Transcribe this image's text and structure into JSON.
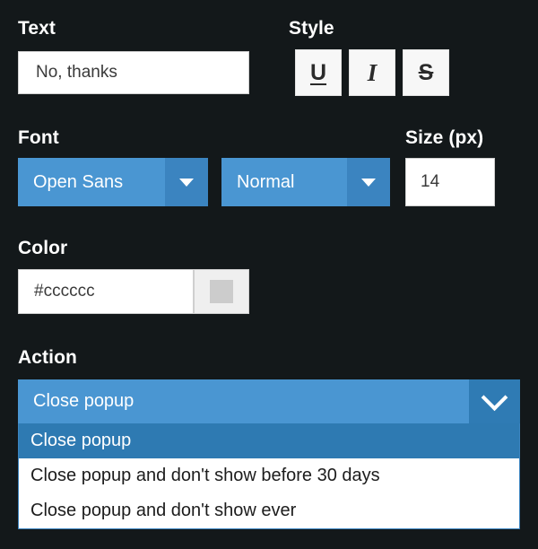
{
  "text_section": {
    "label": "Text",
    "value": "No, thanks",
    "placeholder": "Text"
  },
  "style_section": {
    "label": "Style",
    "buttons": [
      {
        "name": "underline",
        "glyph": "U"
      },
      {
        "name": "italic",
        "glyph": "I"
      },
      {
        "name": "strikethrough",
        "glyph": "S"
      }
    ]
  },
  "font_section": {
    "label": "Font",
    "family": {
      "value": "Open Sans"
    },
    "weight": {
      "value": "Normal"
    }
  },
  "size_section": {
    "label": "Size (px)",
    "value": "14",
    "placeholder": "14"
  },
  "color_section": {
    "label": "Color",
    "value": "#cccccc",
    "placeholder": "#cccccc",
    "swatch_color": "#cccccc"
  },
  "action_section": {
    "label": "Action",
    "selected": "Close popup",
    "options": [
      "Close popup",
      "Close popup and don't show before 30 days",
      "Close popup and don't show ever"
    ]
  },
  "colors": {
    "background": "#13181a",
    "accent_blue": "#4a96d2",
    "accent_blue_dark": "#3b84c0",
    "option_selected": "#2e7ab2",
    "label_text": "#ffffff",
    "input_background": "#ffffff"
  }
}
